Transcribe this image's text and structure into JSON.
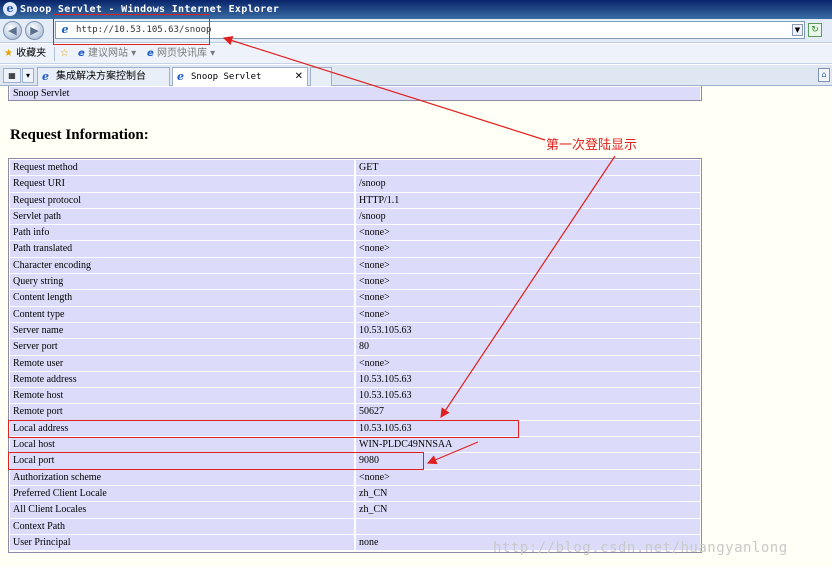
{
  "window": {
    "title": "Snoop Servlet - Windows Internet Explorer"
  },
  "address_bar": {
    "url": "http://10.53.105.63/snoop"
  },
  "favorites_bar": {
    "favorites_label": "收藏夹",
    "items": [
      "建议网站 ▾",
      "网页快讯库 ▾"
    ]
  },
  "tabs": [
    {
      "label": "集成解决方案控制台",
      "active": false
    },
    {
      "label": "Snoop Servlet",
      "active": true
    }
  ],
  "page": {
    "top_cell": "Snoop Servlet",
    "heading": "Request Information:",
    "rows": [
      {
        "name": "Request method",
        "value": "GET"
      },
      {
        "name": "Request URI",
        "value": "/snoop"
      },
      {
        "name": "Request protocol",
        "value": "HTTP/1.1"
      },
      {
        "name": "Servlet path",
        "value": "/snoop"
      },
      {
        "name": "Path info",
        "value": "<none>"
      },
      {
        "name": "Path translated",
        "value": "<none>"
      },
      {
        "name": "Character encoding",
        "value": "<none>"
      },
      {
        "name": "Query string",
        "value": "<none>"
      },
      {
        "name": "Content length",
        "value": "<none>"
      },
      {
        "name": "Content type",
        "value": "<none>"
      },
      {
        "name": "Server name",
        "value": "10.53.105.63"
      },
      {
        "name": "Server port",
        "value": "80"
      },
      {
        "name": "Remote user",
        "value": "<none>"
      },
      {
        "name": "Remote address",
        "value": "10.53.105.63"
      },
      {
        "name": "Remote host",
        "value": "10.53.105.63"
      },
      {
        "name": "Remote port",
        "value": "50627"
      },
      {
        "name": "Local address",
        "value": "10.53.105.63"
      },
      {
        "name": "Local host",
        "value": "WIN-PLDC49NNSAA"
      },
      {
        "name": "Local port",
        "value": "9080"
      },
      {
        "name": "Authorization scheme",
        "value": "<none>"
      },
      {
        "name": "Preferred Client Locale",
        "value": "zh_CN"
      },
      {
        "name": "All Client Locales",
        "value": "zh_CN"
      },
      {
        "name": "Context Path",
        "value": ""
      },
      {
        "name": "User Principal",
        "value": "none"
      }
    ]
  },
  "annotation": {
    "text": "第一次登陆显示",
    "color": "#e02020"
  },
  "watermark": "http://blog.csdn.net/huangyanlong",
  "icons": {
    "app": "ie-icon",
    "back": "back-arrow-icon",
    "forward": "forward-arrow-icon",
    "refresh": "refresh-icon",
    "favorites": "star-icon",
    "close": "close-icon"
  }
}
